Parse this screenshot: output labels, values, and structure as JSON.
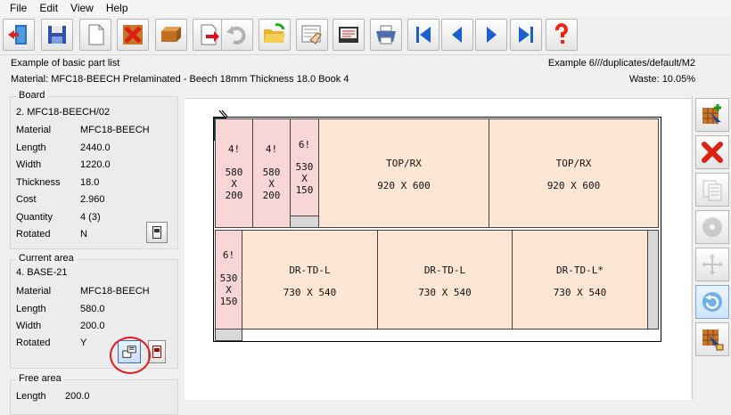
{
  "menu": [
    "File",
    "Edit",
    "View",
    "Help"
  ],
  "toolbar": {
    "buttons": [
      {
        "name": "exit-icon"
      },
      {
        "name": "save-icon"
      },
      {
        "name": "new-icon"
      },
      {
        "name": "delete-icon"
      },
      {
        "name": "board-icon"
      },
      {
        "name": "export-icon"
      },
      {
        "name": "undo-icon"
      },
      {
        "name": "open-folder-icon"
      },
      {
        "name": "hand-pointer-icon"
      },
      {
        "name": "report-icon"
      },
      {
        "name": "print-icon"
      },
      {
        "name": "first-icon"
      },
      {
        "name": "previous-icon"
      },
      {
        "name": "next-icon"
      },
      {
        "name": "last-icon"
      },
      {
        "name": "help-icon"
      }
    ]
  },
  "header": {
    "title": "Example of basic part list",
    "path": "Example 6///duplicates/default/M2",
    "material": "Material: MFC18-BEECH Prelaminated - Beech 18mm Thickness  18.0 Book 4",
    "waste": "Waste: 10.05%"
  },
  "board": {
    "title": "Board",
    "id": "2. MFC18-BEECH/02",
    "rows": [
      {
        "k": "Material",
        "v": "MFC18-BEECH"
      },
      {
        "k": "Length",
        "v": "2440.0"
      },
      {
        "k": "Width",
        "v": "1220.0"
      },
      {
        "k": "Thickness",
        "v": "18.0"
      },
      {
        "k": "Cost",
        "v": "2.960"
      },
      {
        "k": "Quantity",
        "v": "4 (3)"
      },
      {
        "k": "Rotated",
        "v": "N"
      }
    ]
  },
  "current_area": {
    "title": "Current area",
    "id": "4. BASE-21",
    "rows": [
      {
        "k": "Material",
        "v": "MFC18-BEECH"
      },
      {
        "k": "Length",
        "v": "580.0"
      },
      {
        "k": "Width",
        "v": "200.0"
      },
      {
        "k": "Rotated",
        "v": "Y"
      }
    ]
  },
  "free_area": {
    "title": "Free area",
    "rows": [
      {
        "k": "Length",
        "v": "200.0"
      }
    ]
  },
  "parts": [
    {
      "id": "p1",
      "l1": "4!",
      "l2": "580",
      "l3": "X",
      "l4": "200"
    },
    {
      "id": "p2",
      "l1": "4!",
      "l2": "580",
      "l3": "X",
      "l4": "200"
    },
    {
      "id": "p3",
      "l1": "6!",
      "l2": "530",
      "l3": "X",
      "l4": "150"
    },
    {
      "id": "p4",
      "l1": "TOP/RX",
      "l2": "920 X 600"
    },
    {
      "id": "p5",
      "l1": "TOP/RX",
      "l2": "920 X 600"
    },
    {
      "id": "p6",
      "l1": "6!",
      "l2": "530",
      "l3": "X",
      "l4": "150"
    },
    {
      "id": "p7",
      "l1": "DR-TD-L",
      "l2": "730 X 540"
    },
    {
      "id": "p8",
      "l1": "DR-TD-L",
      "l2": "730 X 540"
    },
    {
      "id": "p9",
      "l1": "DR-TD-L*",
      "l2": "730 X 540"
    }
  ],
  "right_toolbar": [
    "add-part-icon",
    "remove-icon",
    "copy-list-icon",
    "saw-icon",
    "move-icon",
    "rotate-icon",
    "select-part-icon"
  ]
}
